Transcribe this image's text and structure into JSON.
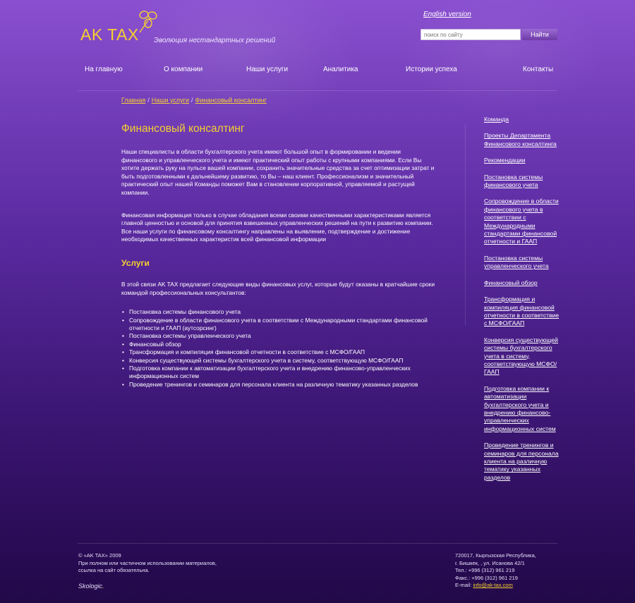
{
  "header": {
    "logo": "AK TAX",
    "tagline": "Эволюция нестандартных решений",
    "english_link": "English version",
    "search_placeholder": "поиск по сайту",
    "search_button": "Найти"
  },
  "nav": [
    "На главную",
    "О компании",
    "Наши услуги",
    "Аналитика",
    "Истории успеха",
    "Контакты"
  ],
  "breadcrumb": {
    "items": [
      "Главная",
      "Наши услуги",
      "Финансовый консалтинг"
    ],
    "separator": "/"
  },
  "main": {
    "title": "Финансовый консалтинг",
    "paragraphs": [
      "Наши специалисты в области бухгалтерского учета имеют большой опыт в формировании и ведении финансового и управленческого учета и имеют практический опыт работы с крупными компаниями. Если Вы хотите держать руку на пульсе вашей компании, сохранить значительные средства за счет оптимизации затрат и быть подготовленными к дальнейшему развитию, то Вы – наш клиент. Профессионализм и значительный практический опыт нашей Команды поможет Вам в становлении корпоративной, управляемой и растущей компании.",
      "Финансовая информация только в случае обладания всеми своими качественными характеристиками является главной ценностью и основой для принятия взвешенных управленческих решений на пути к развитию компании. Все наши услуги по финансовому консалтингу направлены на выявление, подтверждение и достижение необходимых качественных характеристик всей финансовой информации"
    ],
    "services_title": "Услуги",
    "services_intro": "В этой связи AK TAX предлагает следующие виды финансовых услуг, которые будут оказаны в кратчайшие сроки командой профессиональных консультантов:",
    "services": [
      "Постановка системы финансового учета",
      "Сопровождение в области финансового учета в соответствии с Международными стандартами финансовой отчетности и ГААП (аутсорсинг)",
      "Постановка системы управленческого учета",
      "Финансовый обзор",
      "Трансформация и компиляция финансовой отчетности в соответствие с МСФО/ГААП",
      "Конверсия существующей системы бухгалтерского учета в систему, соответствующую МСФО/ГААП",
      "Подготовка компании к автоматизации бухгалтерского учета и внедрению финансово-управленческих информационных систем",
      "Проведение тренингов и семинаров для персонала клиента на различную тематику указанных разделов"
    ]
  },
  "sidebar": [
    "Команда",
    "Проекты Департамента Финансового консалтинга",
    "Рекомендации",
    "Постановка системы финансового учета",
    "Сопровождение в области финансового учета в соответствии с Международными стандартами финансовой отчетности и ГААП",
    "Постановка системы управленческого учета",
    "Финансовый обзор",
    "Трансформация и компиляция финансовой отчетности в соответствие с МСФО/ГААП",
    "Конверсия существующей системы бухгалтерского учета в систему, соответствующую МСФО/ГААП",
    "Подготовка компании к автоматизации бухгалтерского учета и внедрению финансово-управленческих информационных систем",
    "Проведение тренингов и семинаров для персонала клиента на различную тематику указанных разделов"
  ],
  "footer": {
    "copyright": "© «AK TAX» 2009",
    "notice_line1": "При полном или частичном использовании материалов,",
    "notice_line2": "ссылка на сайт обязательна.",
    "dev_brand": "Skologic",
    "dev_brand_dot": ".",
    "address_line1": "720017, Кыргызская Республика,",
    "address_line2": "г. Бишкек, , ул. Исанова 42/1",
    "phone": "Тел.: +996 (312) 961 219",
    "fax": "Факс.: +996 (312) 961 219",
    "email_label": "E-mail:",
    "email": "info@ak-tax.com"
  },
  "colors": {
    "accent": "#f5d030",
    "bg_top": "#8a4fd0",
    "bg_bottom": "#220948"
  }
}
